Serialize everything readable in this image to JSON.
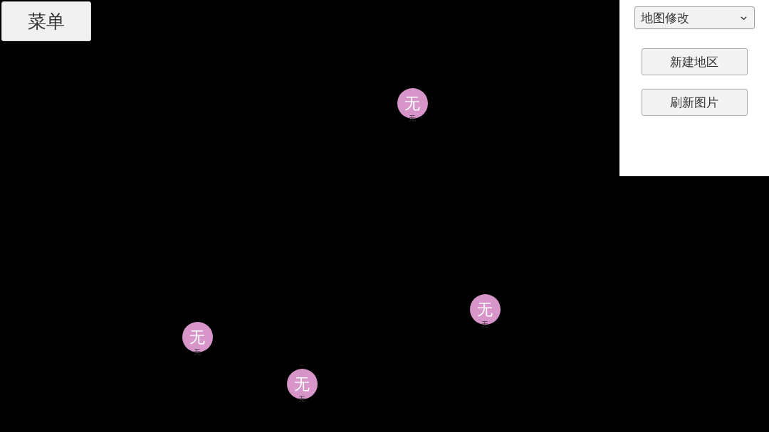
{
  "menu_button": {
    "label": "菜单"
  },
  "side_panel": {
    "dropdown": {
      "value": "地图修改"
    },
    "buttons": [
      "新建地区",
      "刷新图片"
    ]
  },
  "map": {
    "nodes": [
      {
        "text": "无",
        "label": "无"
      },
      {
        "text": "无",
        "label": "无"
      },
      {
        "text": "无",
        "label": "无"
      },
      {
        "text": "无",
        "label": "无"
      }
    ]
  }
}
